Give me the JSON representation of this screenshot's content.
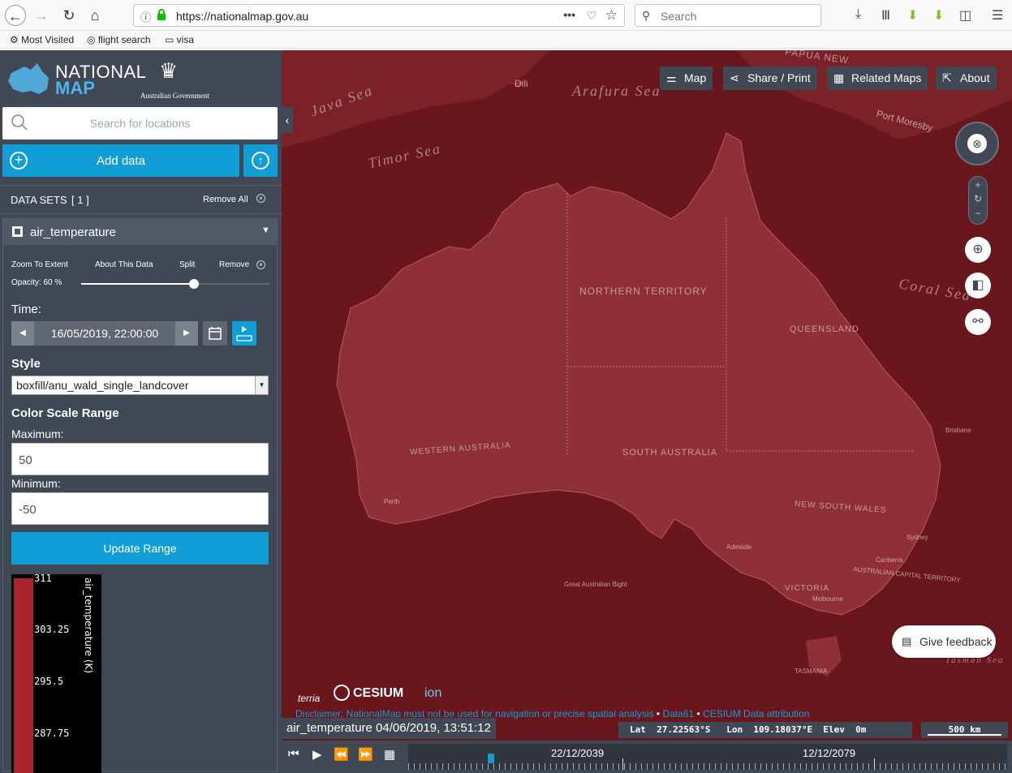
{
  "browser": {
    "url": "https://nationalmap.gov.au",
    "search_placeholder": "Search",
    "bookmarks": [
      "Most Visited",
      "flight search",
      "visa"
    ]
  },
  "app": {
    "logo_line1": "NATIONAL",
    "logo_line2": "MAP",
    "gov_label": "Australian Government"
  },
  "sidebar": {
    "search_placeholder": "Search for locations",
    "add_data_label": "Add data",
    "datasets_title": "DATA SETS",
    "datasets_count": "[ 1 ]",
    "remove_all_label": "Remove All",
    "item": {
      "name": "air_temperature",
      "actions": [
        "Zoom To Extent",
        "About This Data",
        "Split",
        "Remove"
      ],
      "opacity_label": "Opacity: 60 %",
      "opacity_value": 0.6,
      "time_label": "Time:",
      "time_value": "16/05/2019, 22:00:00",
      "style_label": "Style",
      "style_value": "boxfill/anu_wald_single_landcover",
      "color_scale_label": "Color Scale Range",
      "maximum_label": "Maximum:",
      "maximum_value": "50",
      "minimum_label": "Minimum:",
      "minimum_value": "-50",
      "update_label": "Update Range",
      "legend": {
        "ticks": [
          "311",
          "303.25",
          "295.5",
          "287.75"
        ],
        "title": "air_temperature (K)",
        "color": "#a8262b"
      }
    }
  },
  "map": {
    "buttons": {
      "map": "Map",
      "share": "Share / Print",
      "related": "Related Maps",
      "about": "About"
    },
    "feedback_label": "Give feedback",
    "brand_terria": "terria",
    "brand_cesium": "CESIUM",
    "brand_ion": "ion",
    "disclaimer": "Disclaimer: NationalMap must not be used for navigation or precise spatial analysis",
    "data61": "Data61",
    "cesium_link": "CESIUM",
    "attribution": "Data attribution",
    "dataset_time": "air_temperature 04/06/2019, 13:51:12",
    "coords": "Lat  27.22563°S   Lon  109.18037°E  Elev  0m",
    "scale_label": "500 km",
    "timeline_labels": [
      "22/12/2039",
      "12/12/2079"
    ],
    "labels": {
      "sea1": "Java Sea",
      "sea2": "Timor Sea",
      "sea3": "Arafura Sea",
      "sea4": "Coral Sea",
      "dili": "Dili",
      "papua": "PAPUA NEW",
      "port": "Port Moresby",
      "nt": "NORTHERN TERRITORY",
      "qld": "QUEENSLAND",
      "wa": "WESTERN AUSTRALIA",
      "sa": "SOUTH AUSTRALIA",
      "nsw": "NEW SOUTH WALES",
      "vic": "VICTORIA",
      "act": "AUSTRALIAN CAPITAL TERRITORY",
      "tas": "TASMANIA",
      "bight": "Great Australian Bight",
      "tasman": "Tasman Sea",
      "brisbane": "Brisbane",
      "sydney": "Sydney",
      "canberra": "Canberra",
      "melbourne": "Melbourne",
      "adelaide": "Adelaide",
      "perth": "Perth"
    }
  },
  "colors": {
    "sidebar": "#3f4854",
    "accent": "#119dd5",
    "map_overlay": "#6b151c"
  }
}
